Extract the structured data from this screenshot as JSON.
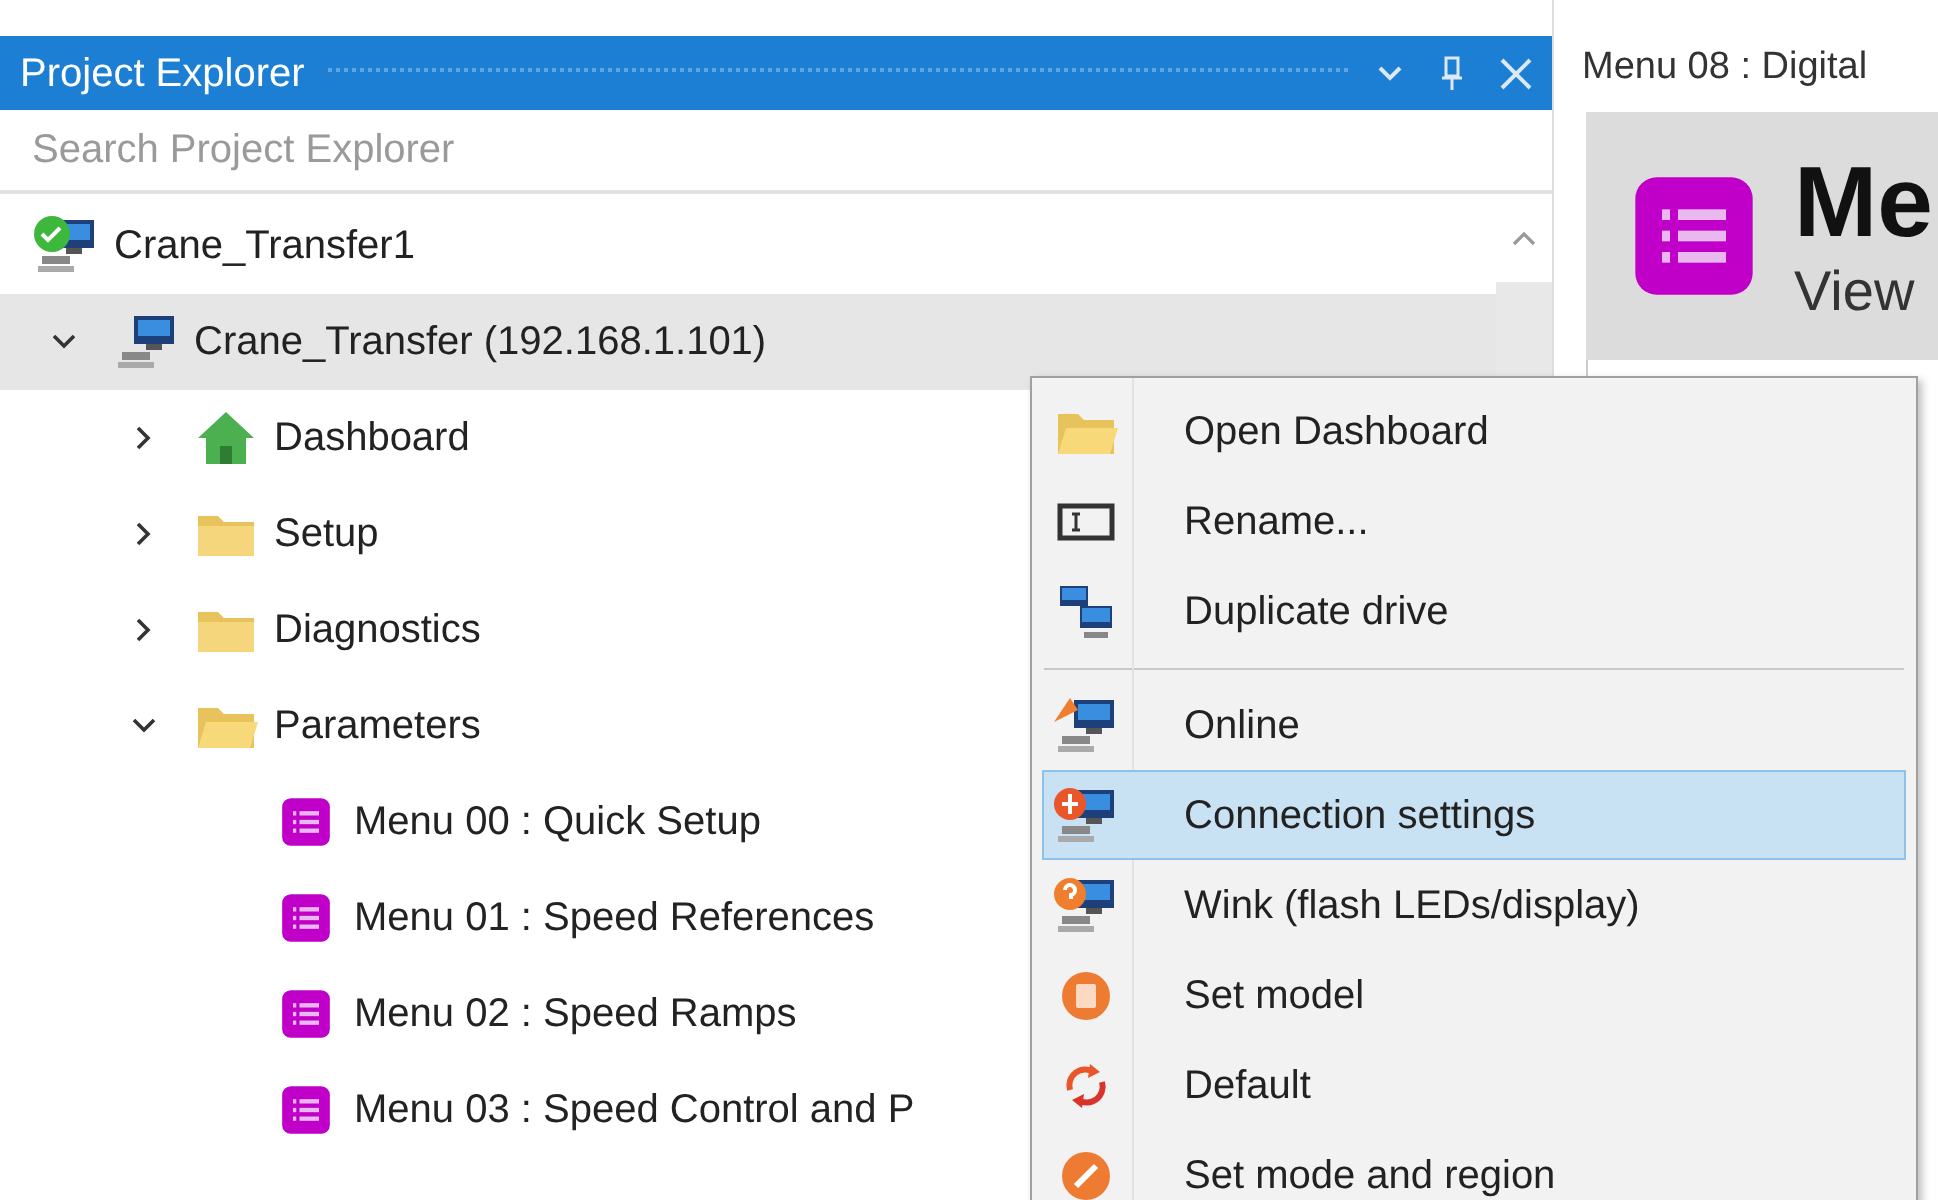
{
  "panel": {
    "title": "Project Explorer"
  },
  "search": {
    "placeholder": "Search Project Explorer"
  },
  "tree": [
    {
      "label": "Crane_Transfer1",
      "kind": "drive",
      "online": true,
      "selected": false
    },
    {
      "label": "Crane_Transfer (192.168.1.101)",
      "kind": "drive",
      "online": false,
      "selected": true,
      "expanded": true,
      "children": [
        {
          "label": "Dashboard",
          "kind": "dashboard",
          "selected": false,
          "expanded": false
        },
        {
          "label": "Setup",
          "kind": "folder",
          "selected": false,
          "expanded": false
        },
        {
          "label": "Diagnostics",
          "kind": "folder",
          "selected": false,
          "expanded": false
        },
        {
          "label": "Parameters",
          "kind": "folder",
          "selected": false,
          "expanded": true,
          "children": [
            {
              "label": "Menu 00 : Quick Setup",
              "kind": "menu",
              "selected": false
            },
            {
              "label": "Menu 01 : Speed References",
              "kind": "menu",
              "selected": false
            },
            {
              "label": "Menu 02 : Speed Ramps",
              "kind": "menu",
              "selected": false
            },
            {
              "label": "Menu 03 : Speed Control and P",
              "kind": "menu",
              "selected": false
            }
          ]
        }
      ]
    }
  ],
  "document": {
    "tab": "Menu 08 : Digital",
    "heading": "Me",
    "subheading": "View"
  },
  "context_menu": [
    {
      "kind": "item",
      "label": "Open Dashboard",
      "selected": false
    },
    {
      "kind": "item",
      "label": "Rename...",
      "selected": false
    },
    {
      "kind": "item",
      "label": "Duplicate drive",
      "selected": false
    },
    {
      "kind": "separator"
    },
    {
      "kind": "item",
      "label": "Online",
      "selected": false
    },
    {
      "kind": "item",
      "label": "Connection settings",
      "selected": true
    },
    {
      "kind": "item",
      "label": "Wink (flash LEDs/display)",
      "selected": false
    },
    {
      "kind": "item",
      "label": "Set model",
      "selected": false
    },
    {
      "kind": "item",
      "label": "Default",
      "selected": false
    },
    {
      "kind": "item",
      "label": "Set mode and region",
      "selected": false
    }
  ]
}
